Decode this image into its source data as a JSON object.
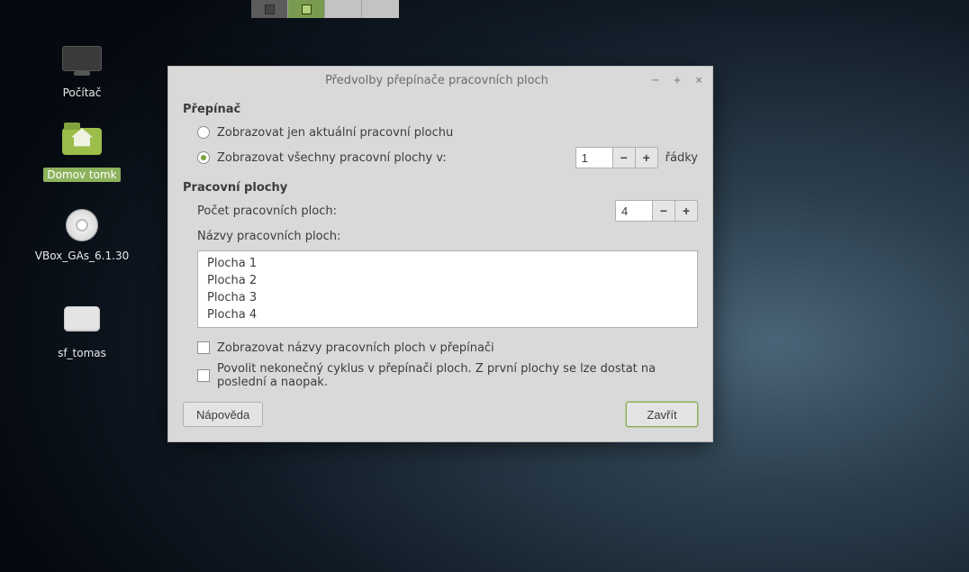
{
  "desktop": {
    "workspace_switcher": {
      "count": 4,
      "active_index": 1
    },
    "icons": [
      {
        "name": "computer",
        "label": "Počítač",
        "selected": false
      },
      {
        "name": "home",
        "label": "Domov tomk",
        "selected": true
      },
      {
        "name": "optical",
        "label": "VBox_GAs_6.1.30",
        "selected": false
      },
      {
        "name": "share",
        "label": "sf_tomas",
        "selected": false
      }
    ]
  },
  "dialog": {
    "title": "Předvolby přepínače pracovních ploch",
    "section_switcher": "Přepínač",
    "radio_current_only": "Zobrazovat jen aktuální pracovní plochu",
    "radio_all": "Zobrazovat všechny pracovní plochy v:",
    "rows_value": "1",
    "rows_suffix": "řádky",
    "section_workspaces": "Pracovní plochy",
    "count_label": "Počet pracovních ploch:",
    "count_value": "4",
    "names_label": "Názvy pracovních ploch:",
    "workspace_names": [
      "Plocha 1",
      "Plocha 2",
      "Plocha 3",
      "Plocha 4"
    ],
    "chk_show_names": "Zobrazovat názvy pracovních ploch v přepínači",
    "chk_wrap": "Povolit nekonečný cyklus v přepínači ploch. Z první plochy se lze dostat na poslední a naopak.",
    "btn_help": "Nápověda",
    "btn_close": "Zavřít"
  }
}
